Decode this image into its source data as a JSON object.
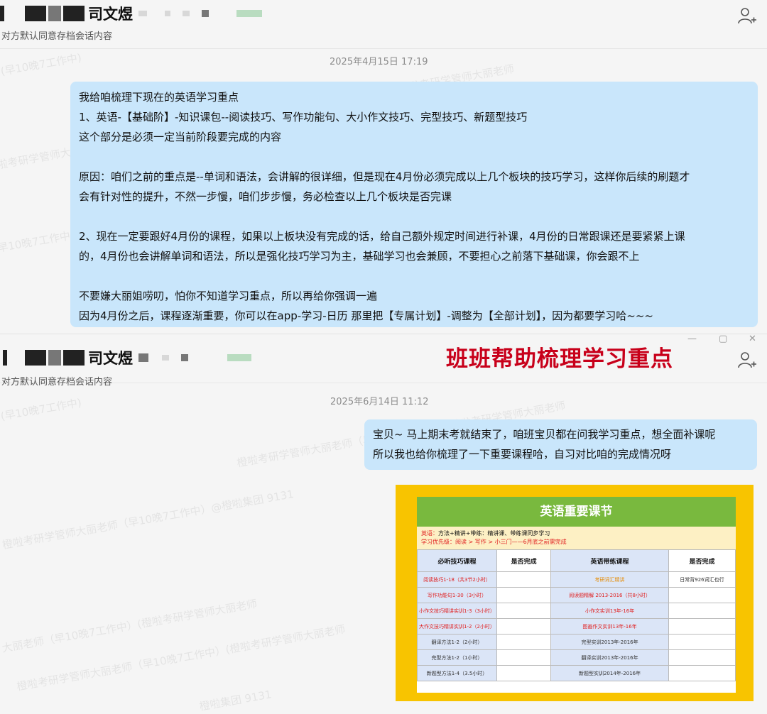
{
  "pane1": {
    "contact_name": "司文煜",
    "subtitle": "对方默认同意存档会话内容",
    "timestamp": "2025年4月15日 17:19",
    "message_lines": [
      "我给咱梳理下现在的英语学习重点",
      "1、英语-【基础阶】-知识课包--阅读技巧、写作功能句、大小作文技巧、完型技巧、新题型技巧",
      "这个部分是必须一定当前阶段要完成的内容",
      "",
      "原因：咱们之前的重点是--单词和语法，会讲解的很详细，但是现在4月份必须完成以上几个板块的技巧学习，这样你后续的刷题才",
      "会有针对性的提升，不然一步慢，咱们步步慢，务必检查以上几个板块是否完课",
      "",
      "2、现在一定要跟好4月份的课程，如果以上板块没有完成的话，给自己额外规定时间进行补课，4月份的日常跟课还是要紧紧上课",
      "的，4月份也会讲解单词和语法，所以是强化技巧学习为主，基础学习也会兼顾，不要担心之前落下基础课，你会跟不上",
      "",
      "不要嫌大丽姐唠叨，怕你不知道学习重点，所以再给你强调一遍",
      "因为4月份之后，课程逐渐重要，你可以在app-学习-日历 那里把【专属计划】-调整为【全部计划】，因为都要学习哈~~~"
    ]
  },
  "banner": "班班帮助梳理学习重点",
  "pane2": {
    "contact_name": "司文煜",
    "subtitle": "对方默认同意存档会话内容",
    "timestamp": "2025年6月14日 11:12",
    "message_lines": [
      "宝贝~ 马上期末考就结束了，咱班宝贝都在问我学习重点，想全面补课呢",
      "所以我也给你梳理了一下重要课程哈，自习对比咱的完成情况呀"
    ],
    "table": {
      "title": "英语重要课节",
      "note_line1_label": "英语：",
      "note_line1_text": "方法+精讲+带练：精讲课、带练课同步学习",
      "note_line2": "学习优先级：阅读 > 写作 > 小三门——6月底之前需完成",
      "headers": [
        "必听技巧课程",
        "是否完成",
        "英语带练课程",
        "是否完成"
      ],
      "rows": [
        [
          "阅读技巧1-18（共3节2小时）",
          "",
          "考研词汇精讲",
          "日常背926词汇也行"
        ],
        [
          "写作功能句1-30（3小时）",
          "",
          "阅读题精解 2013-2016（共8小时）",
          ""
        ],
        [
          "小作文技巧精讲实训1-3（3小时）",
          "",
          "小作文实训13年-16年",
          ""
        ],
        [
          "大作文技巧精讲实训1-2（2小时）",
          "",
          "图画作文实训13年-16年",
          ""
        ],
        [
          "翻译方法1-2（2小时）",
          "",
          "完型实训2013年-2016年",
          ""
        ],
        [
          "完型方法1-2（1小时）",
          "",
          "翻译实训2013年-2016年",
          ""
        ],
        [
          "新题型方法1-4（3.5小时）",
          "",
          "新题型实训2014年-2016年",
          ""
        ]
      ]
    }
  },
  "watermark_texts": [
    "(早10晚7工作中)",
    "橙啦考研学管师大丽老师",
    "橙啦考研学管师大丽老师（早10晚7工作中）(橙啦考研学管师大丽老师",
    "橙啦考研学管师大丽老师（早10晚7工作中）@橙啦集团 9131",
    "大丽老师（早10晚7工作中）(橙啦考研学管师大丽老师",
    "橙啦集团 9131"
  ]
}
